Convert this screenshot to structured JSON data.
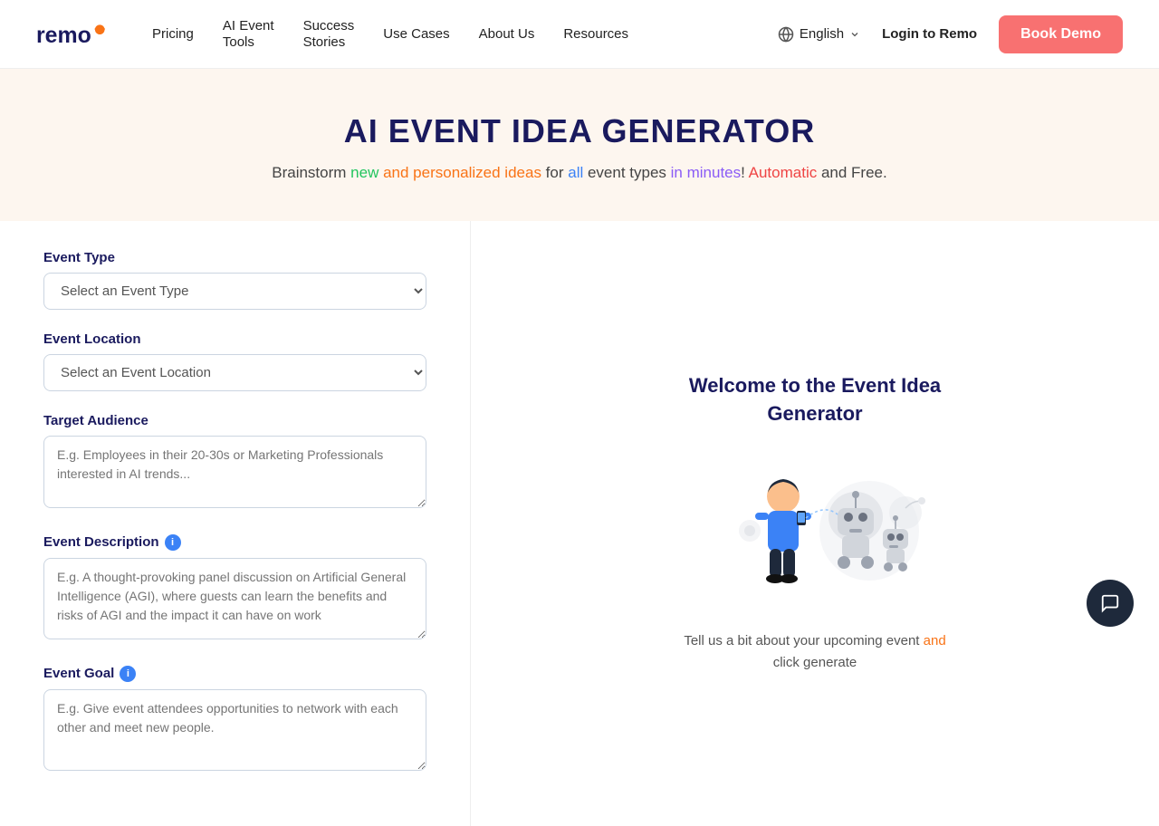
{
  "nav": {
    "logo_text": "remo",
    "links": [
      {
        "label": "Pricing",
        "name": "pricing"
      },
      {
        "label": "AI Event",
        "label2": "Tools",
        "name": "ai-event-tools"
      },
      {
        "label": "Success",
        "label2": "Stories",
        "name": "success-stories"
      },
      {
        "label": "Use Cases",
        "name": "use-cases"
      },
      {
        "label": "About Us",
        "name": "about-us"
      },
      {
        "label": "Resources",
        "name": "resources"
      }
    ],
    "language": "English",
    "login_label": "Login to Remo",
    "book_demo_label": "Book Demo"
  },
  "hero": {
    "title": "AI EVENT IDEA GENERATOR",
    "subtitle": "Brainstorm new and personalized ideas for all event types in minutes! Automatic and Free."
  },
  "form": {
    "event_type_label": "Event Type",
    "event_type_placeholder": "Select an Event Type",
    "event_location_label": "Event Location",
    "event_location_placeholder": "Select an Event Location",
    "target_audience_label": "Target Audience",
    "target_audience_placeholder": "E.g. Employees in their 20-30s or Marketing Professionals interested in AI trends...",
    "event_description_label": "Event Description",
    "event_description_placeholder": "E.g. A thought-provoking panel discussion on Artificial General Intelligence (AGI), where guests can learn the benefits and risks of AGI and the impact it can have on work",
    "event_goal_label": "Event Goal",
    "event_goal_placeholder": "E.g. Give event attendees opportunities to network with each other and meet new people."
  },
  "welcome": {
    "title": "Welcome to the Event Idea Generator",
    "subtitle_normal": "Tell us a bit about your upcoming event and click generate",
    "subtitle_highlight": "Tell us a bit about your upcoming event and click generate"
  },
  "chat": {
    "icon": "💬"
  }
}
